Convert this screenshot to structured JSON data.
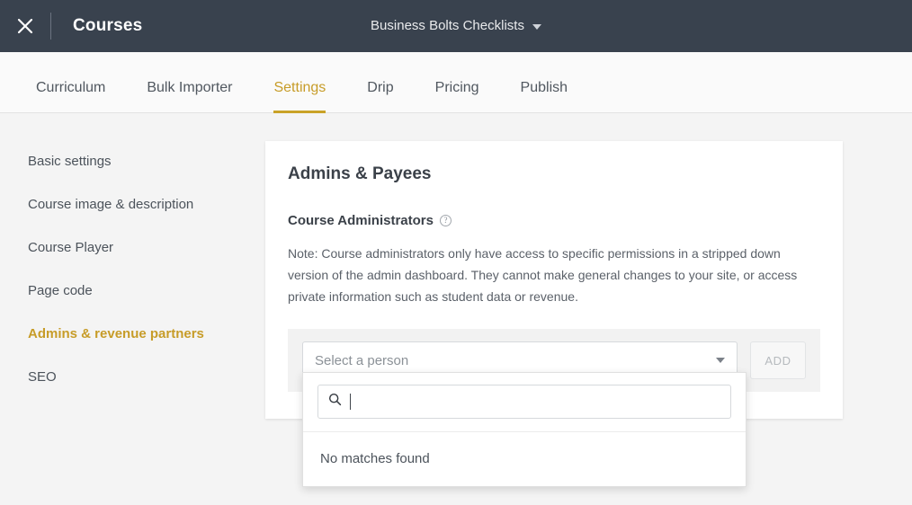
{
  "topbar": {
    "close_icon": "close-icon",
    "title": "Courses",
    "course_name": "Business Bolts Checklists",
    "course_caret_icon": "chevron-down-icon",
    "background_color": "#39424e"
  },
  "tabs": [
    {
      "label": "Curriculum",
      "active": false
    },
    {
      "label": "Bulk Importer",
      "active": false
    },
    {
      "label": "Settings",
      "active": true
    },
    {
      "label": "Drip",
      "active": false
    },
    {
      "label": "Pricing",
      "active": false
    },
    {
      "label": "Publish",
      "active": false
    }
  ],
  "accent_color": "#c9a227",
  "sidebar": {
    "items": [
      {
        "label": "Basic settings",
        "active": false
      },
      {
        "label": "Course image & description",
        "active": false
      },
      {
        "label": "Course Player",
        "active": false
      },
      {
        "label": "Page code",
        "active": false
      },
      {
        "label": "Admins & revenue partners",
        "active": true
      },
      {
        "label": "SEO",
        "active": false
      }
    ]
  },
  "card": {
    "title": "Admins & Payees",
    "section_label": "Course Administrators",
    "help_icon_glyph": "?",
    "note": "Note: Course administrators only have access to specific permissions in a stripped down version of the admin dashboard. They cannot make general changes to your site, or access private information such as student data or revenue.",
    "select": {
      "placeholder": "Select a person",
      "caret_icon": "chevron-down-icon"
    },
    "add_button_label": "ADD"
  },
  "dropdown": {
    "search_icon": "search-icon",
    "search_value": "",
    "empty_message": "No matches found"
  }
}
